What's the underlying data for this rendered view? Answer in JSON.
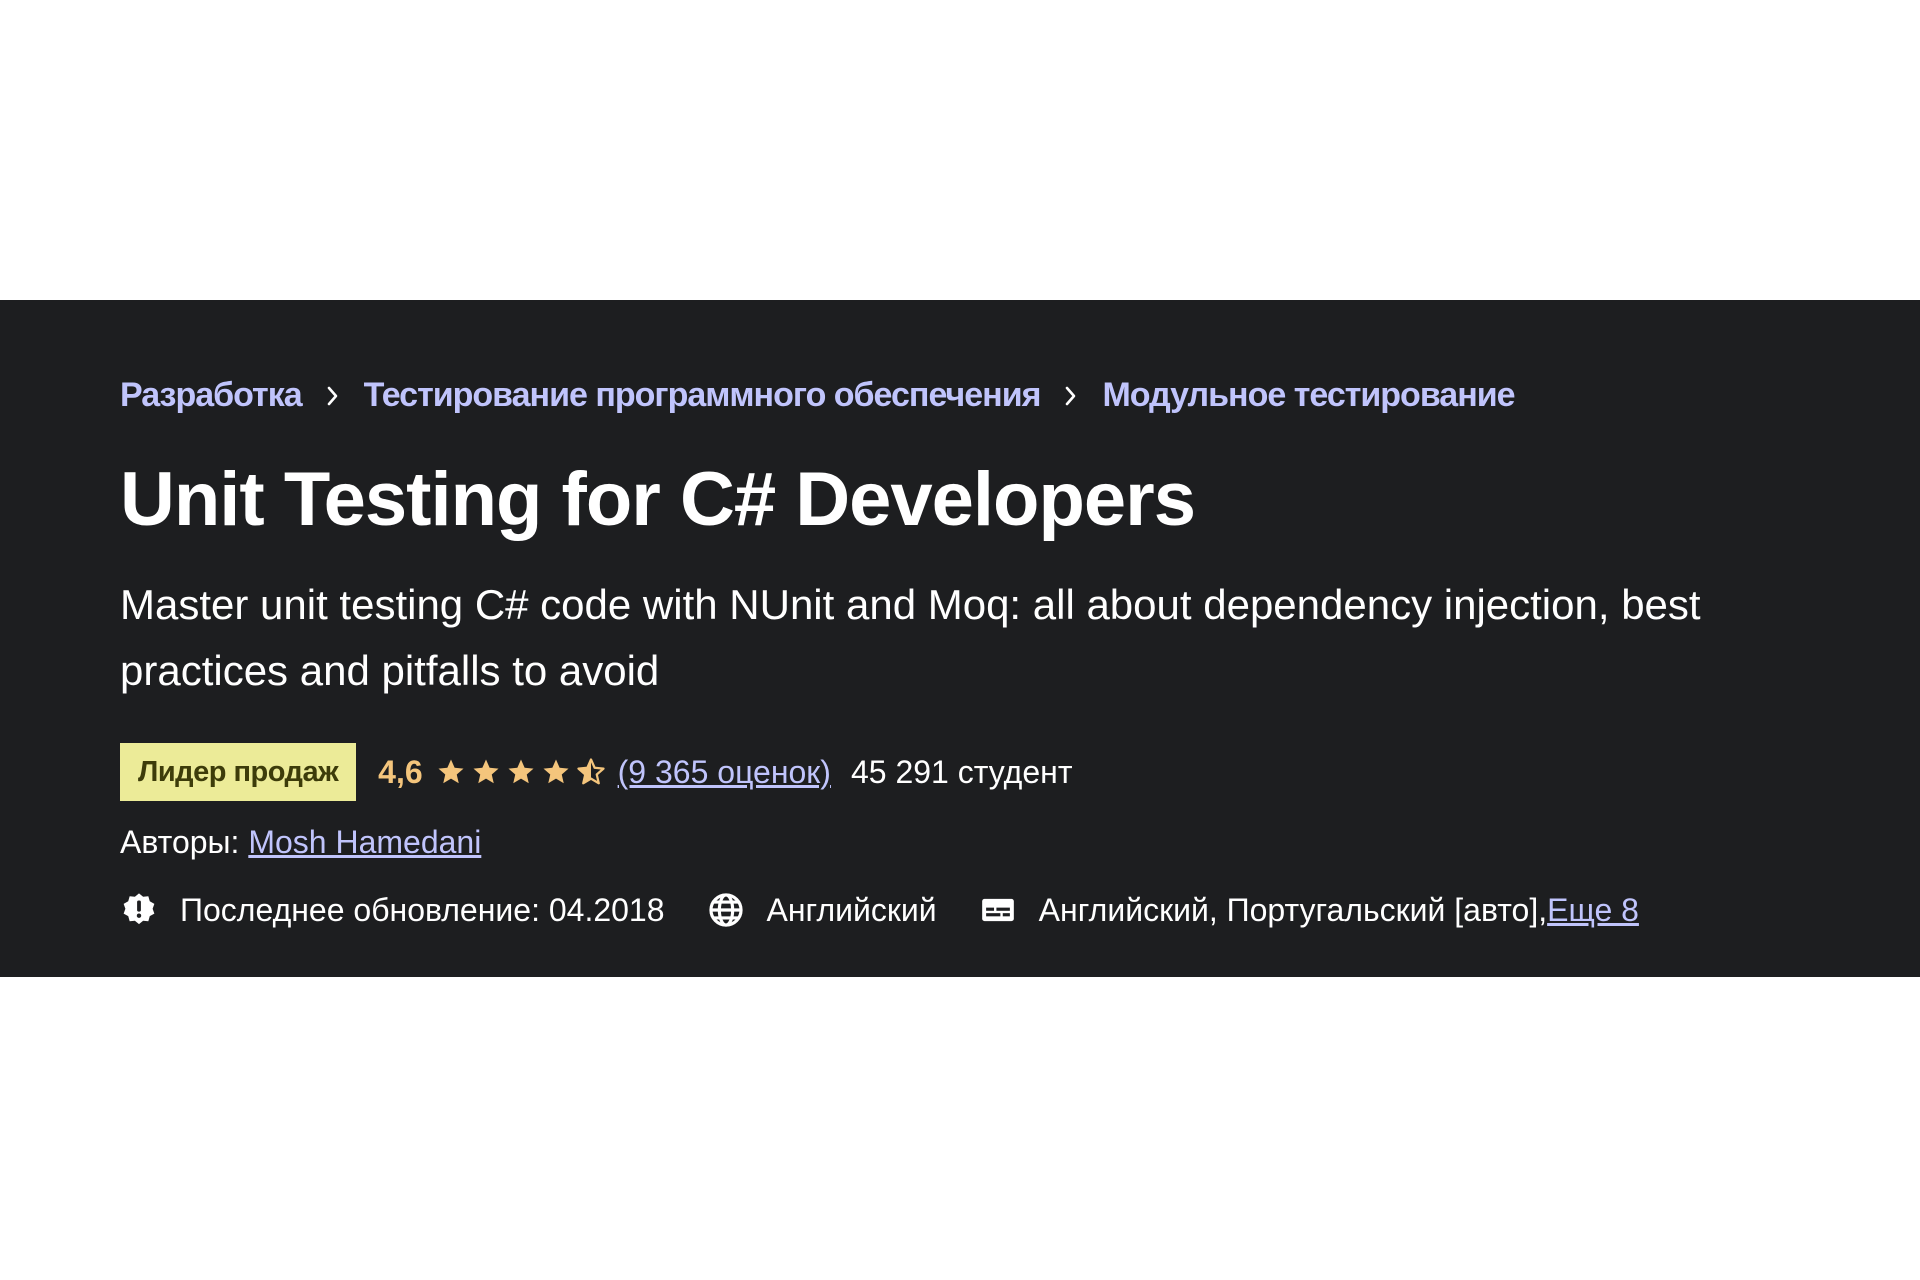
{
  "breadcrumb": {
    "items": [
      {
        "label": "Разработка"
      },
      {
        "label": "Тестирование программного обеспечения"
      },
      {
        "label": "Модульное тестирование"
      }
    ]
  },
  "course": {
    "title": "Unit Testing for C# Developers",
    "subtitle": "Master unit testing C# code with NUnit and Moq: all about dependency injection, best practices and pitfalls to avoid"
  },
  "stats": {
    "badge": "Лидер продаж",
    "rating": "4,6",
    "rating_value": 4.6,
    "ratings_link": "(9 365 оценок)",
    "students": "45 291 студент"
  },
  "authors": {
    "label": "Авторы: ",
    "name": "Mosh Hamedani"
  },
  "info": {
    "updated": "Последнее обновление: 04.2018",
    "language": "Английский",
    "captions": "Английский, Португальский [авто], ",
    "more": "Еще 8"
  },
  "icons": {
    "chevron": "chevron-right-icon",
    "star": "star-icon",
    "update": "alert-badge-icon",
    "language": "globe-icon",
    "captions": "closed-captions-icon"
  },
  "colors": {
    "banner_bg": "#1d1e20",
    "link": "#c0c4fc",
    "badge_bg": "#eceb98",
    "rating": "#f4c57c"
  }
}
